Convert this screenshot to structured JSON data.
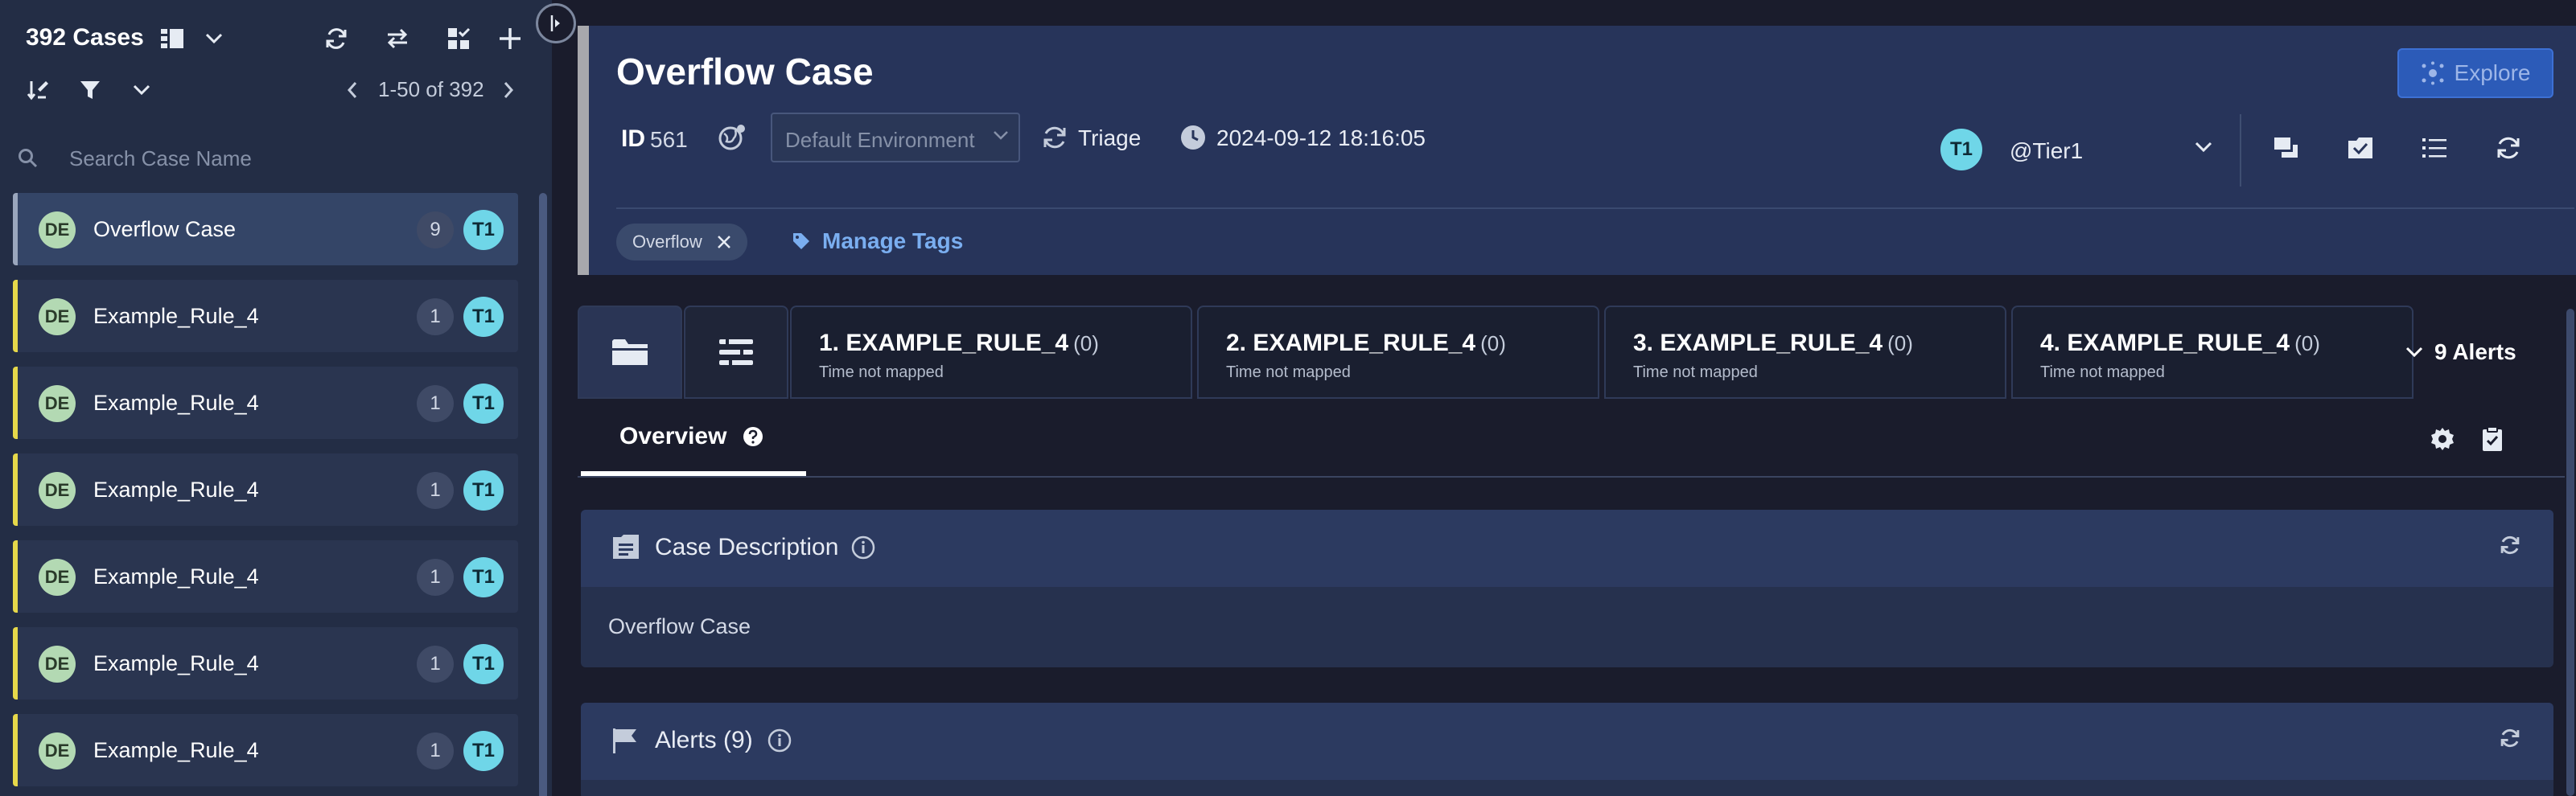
{
  "sidebar": {
    "case_count": "392 Cases",
    "pager": "1-50 of 392",
    "search_placeholder": "Search Case Name",
    "cases": [
      {
        "initials": "DE",
        "name": "Overflow Case",
        "count": "9",
        "tier": "T1",
        "active": true
      },
      {
        "initials": "DE",
        "name": "Example_Rule_4",
        "count": "1",
        "tier": "T1"
      },
      {
        "initials": "DE",
        "name": "Example_Rule_4",
        "count": "1",
        "tier": "T1"
      },
      {
        "initials": "DE",
        "name": "Example_Rule_4",
        "count": "1",
        "tier": "T1"
      },
      {
        "initials": "DE",
        "name": "Example_Rule_4",
        "count": "1",
        "tier": "T1"
      },
      {
        "initials": "DE",
        "name": "Example_Rule_4",
        "count": "1",
        "tier": "T1"
      },
      {
        "initials": "DE",
        "name": "Example_Rule_4",
        "count": "1",
        "tier": "T1"
      }
    ]
  },
  "header": {
    "title": "Overflow Case",
    "explore_label": "Explore",
    "id_label": "ID",
    "id_value": "561",
    "environment_placeholder": "Default Environment",
    "stage": "Triage",
    "timestamp": "2024-09-12 18:16:05",
    "assignee_tier": "T1",
    "assignee_name": "@Tier1",
    "tag": "Overflow",
    "manage_tags_label": "Manage Tags"
  },
  "alert_tabs": [
    {
      "title": "1. EXAMPLE_RULE_4",
      "count": "(0)",
      "subtitle": "Time not mapped"
    },
    {
      "title": "2. EXAMPLE_RULE_4",
      "count": "(0)",
      "subtitle": "Time not mapped"
    },
    {
      "title": "3. EXAMPLE_RULE_4",
      "count": "(0)",
      "subtitle": "Time not mapped"
    },
    {
      "title": "4. EXAMPLE_RULE_4",
      "count": "(0)",
      "subtitle": "Time not mapped"
    }
  ],
  "alerts_toggle_label": "9 Alerts",
  "overview_tab_label": "Overview",
  "panels": {
    "description_title": "Case Description",
    "description_body": "Overflow Case",
    "alerts_title": "Alerts (9)"
  },
  "colors": {
    "tier_badge": "#6fd6e8",
    "avatar": "#b3d9b3",
    "priority_bar": "#e6d84a",
    "explore_button": "#2c5bb8",
    "link": "#7aaef0"
  }
}
